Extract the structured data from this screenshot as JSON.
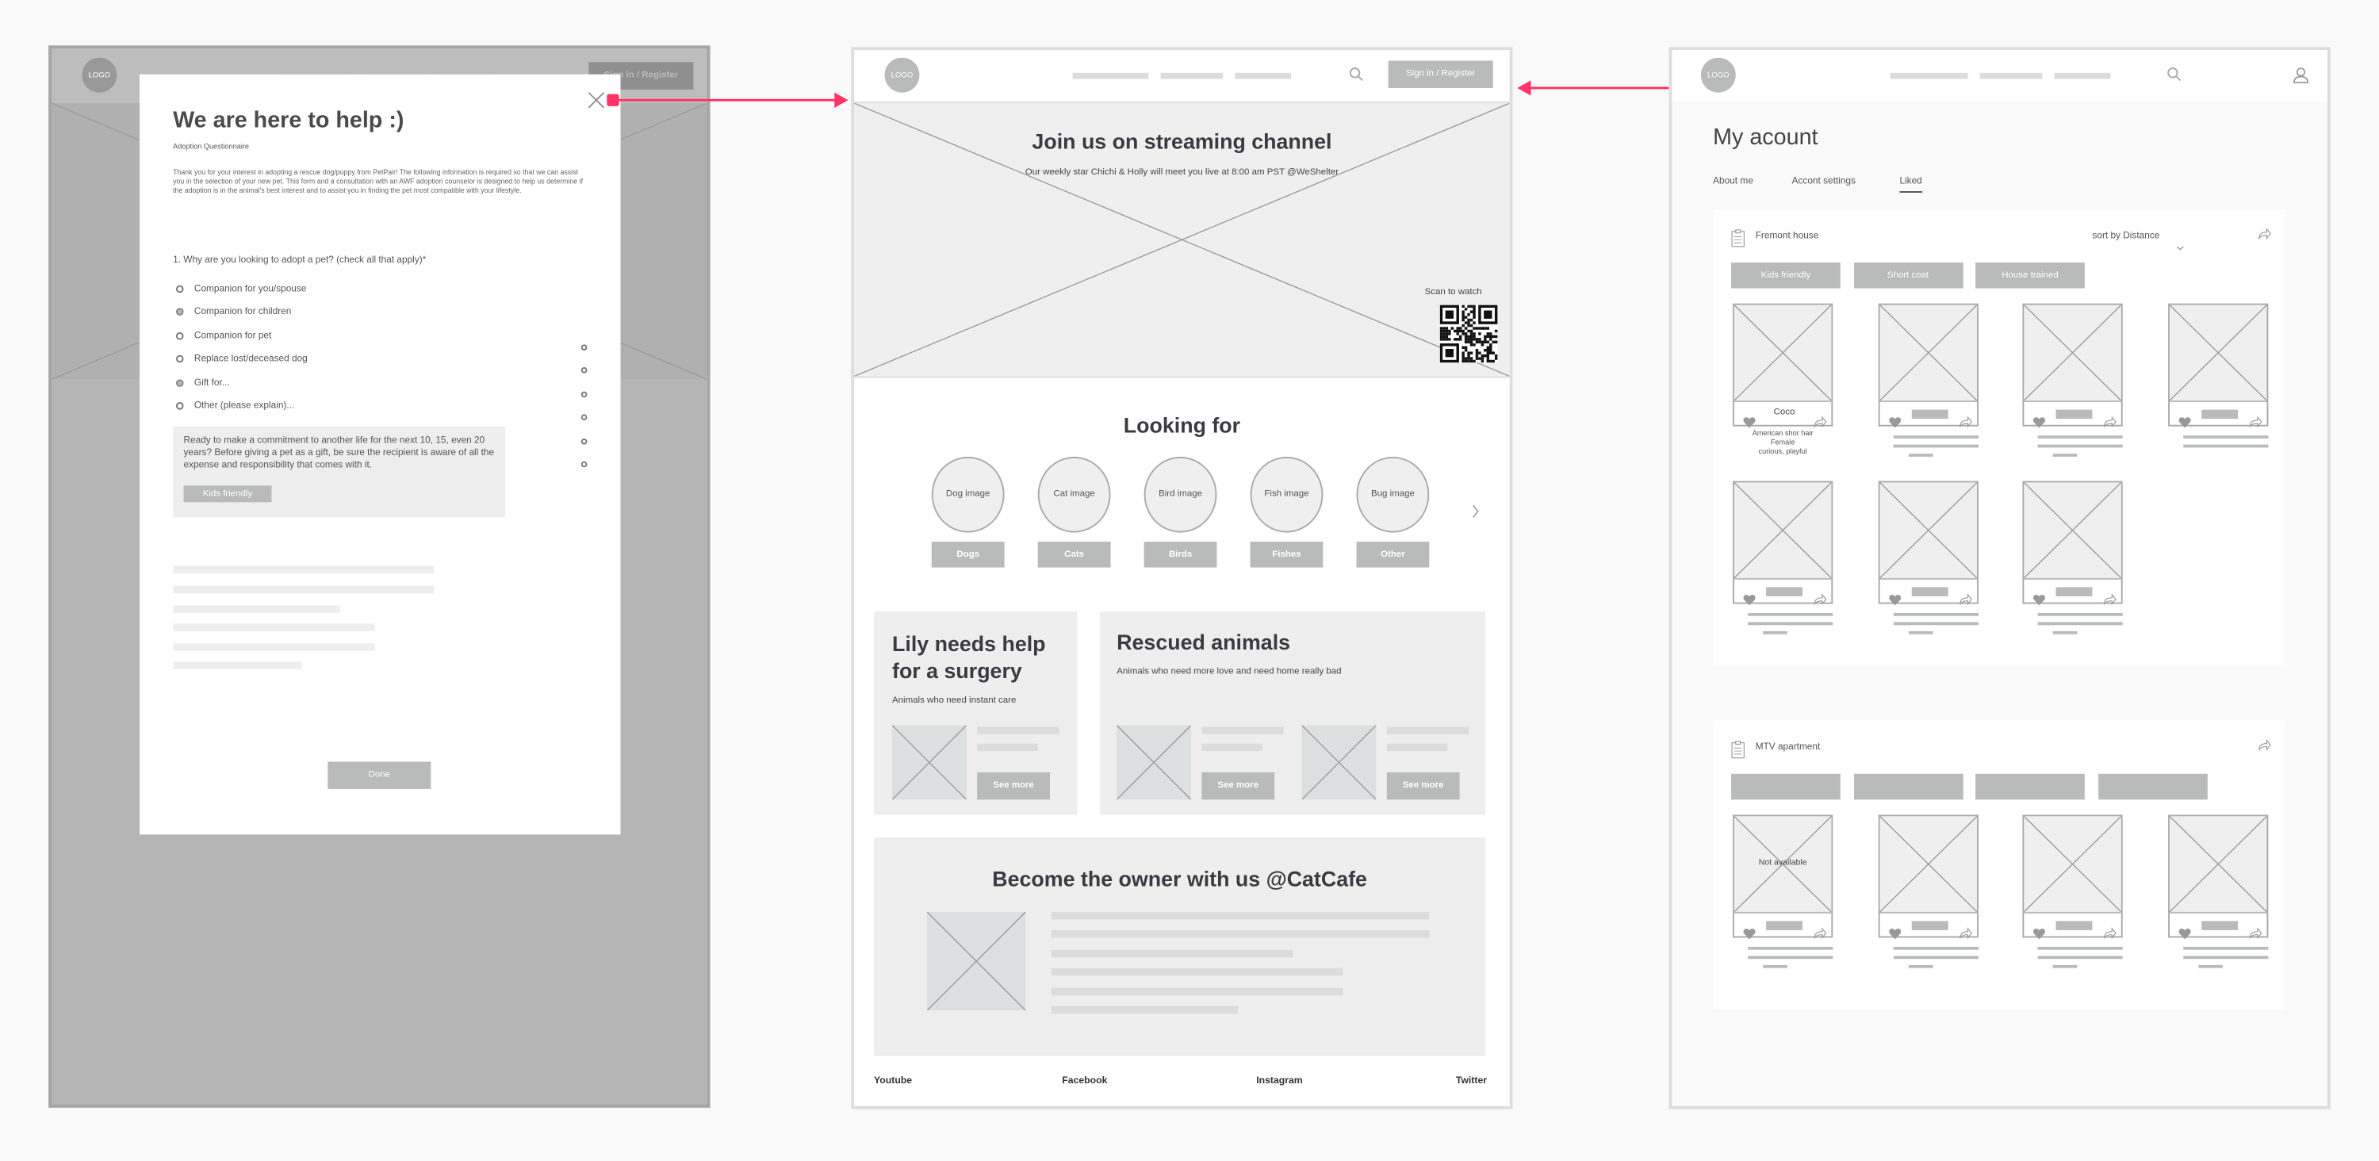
{
  "colors": {
    "accent": "#ff3366",
    "button": "#b9bbbb",
    "placeholder": "#efefef"
  },
  "background_page": {
    "logo": "LOGO",
    "sign_in": "Sign in / Register"
  },
  "modal": {
    "title": "We are here to help :)",
    "subtitle": "Adoption Questionnaire",
    "paragraph": "Thank you for your interest in adopting a rescue dog/puppy from PetPair! The following information is required so that we can assist you in the selection of your new pet. This form and a consultation with an AWF adoption counselor is designed to help us determine if the adoption is in the animal's best interest and to assist you in finding the pet most compatible with your lifestyle.",
    "question": "1. Why are you looking to adopt a pet? (check all that apply)*",
    "options": [
      {
        "label": "Companion for you/spouse",
        "checked": false
      },
      {
        "label": "Companion for children",
        "checked": true
      },
      {
        "label": "Companion for pet",
        "checked": false
      },
      {
        "label": "Replace lost/deceased dog",
        "checked": false
      },
      {
        "label": "Gift for...",
        "checked": true
      },
      {
        "label": "Other (please explain)...",
        "checked": false
      }
    ],
    "info_text": "Ready to make a commitment to another life for the next 10, 15, even 20 years? Before giving a pet as a gift, be sure the recipient is aware of all the expense and responsibility that comes with it.",
    "info_button": "Kids friendly",
    "done": "Done",
    "close_icon": "close-icon"
  },
  "home": {
    "logo": "LOGO",
    "sign_in": "Sign in / Register",
    "hero": {
      "title": "Join us on streaming channel",
      "subtitle": "Our weekly star Chichi & Holly will meet you live at 8:00 am PST @WeShelter",
      "scan": "Scan to watch"
    },
    "looking_for": {
      "title": "Looking for",
      "categories": [
        {
          "image": "Dog image",
          "label": "Dogs"
        },
        {
          "image": "Cat image",
          "label": "Cats"
        },
        {
          "image": "Bird image",
          "label": "Birds"
        },
        {
          "image": "Fish image",
          "label": "Fishes"
        },
        {
          "image": "Bug image",
          "label": "Other"
        }
      ]
    },
    "lily": {
      "title": "Lily needs help for a surgery",
      "subtitle": "Animals who need instant care",
      "see_more": "See more"
    },
    "rescued": {
      "title": "Rescued animals",
      "subtitle": "Animals who need more love and need home really bad",
      "see_more": "See more"
    },
    "become": {
      "title": "Become the owner with us @CatCafe"
    },
    "footer": [
      "Youtube",
      "Facebook",
      "Instagram",
      "Twitter"
    ]
  },
  "account": {
    "logo": "LOGO",
    "title": "My acount",
    "tabs": [
      {
        "label": "About me",
        "active": false
      },
      {
        "label": "Accont settings",
        "active": false
      },
      {
        "label": "Liked",
        "active": true
      }
    ],
    "sections": [
      {
        "name": "Fremont house",
        "sort": "sort by Distance",
        "chips": [
          "Kids friendly",
          "Short coat",
          "House trained"
        ],
        "pets": [
          {
            "name": "Coco",
            "details": [
              "American shor hair",
              "Female",
              "curious, playful"
            ]
          },
          {},
          {},
          {},
          {},
          {},
          {}
        ]
      },
      {
        "name": "MTV apartment",
        "sort": "",
        "chips": [
          "",
          "",
          "",
          ""
        ],
        "pets": [
          {
            "status": "Not available"
          },
          {},
          {},
          {}
        ]
      }
    ]
  }
}
